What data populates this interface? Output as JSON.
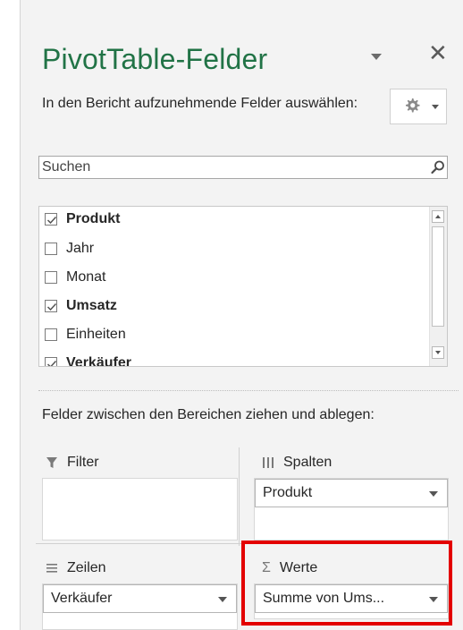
{
  "header": {
    "title": "PivotTable-Felder",
    "subtitle": "In den Bericht aufzunehmende Felder auswählen:",
    "close_icon": "close-icon",
    "menu_icon": "chevron-down-icon",
    "settings_icon": "gear-icon"
  },
  "search": {
    "placeholder": "Suchen",
    "icon": "search-icon"
  },
  "fields": [
    {
      "label": "Produkt",
      "checked": true
    },
    {
      "label": "Jahr",
      "checked": false
    },
    {
      "label": "Monat",
      "checked": false
    },
    {
      "label": "Umsatz",
      "checked": true
    },
    {
      "label": "Einheiten",
      "checked": false
    },
    {
      "label": "Verkäufer",
      "checked": true
    }
  ],
  "areas": {
    "hint": "Felder zwischen den Bereichen ziehen und ablegen:",
    "filter": {
      "label": "Filter",
      "icon": "filter-icon",
      "items": []
    },
    "columns": {
      "label": "Spalten",
      "icon": "columns-icon",
      "items": [
        "Produkt"
      ]
    },
    "rows": {
      "label": "Zeilen",
      "icon": "rows-icon",
      "items": [
        "Verkäufer"
      ]
    },
    "values": {
      "label": "Werte",
      "icon": "sigma-icon",
      "items": [
        "Summe von Ums..."
      ]
    }
  },
  "colors": {
    "title": "#217346",
    "highlight": "#e30000",
    "pane_background": "#f3f3f3"
  }
}
